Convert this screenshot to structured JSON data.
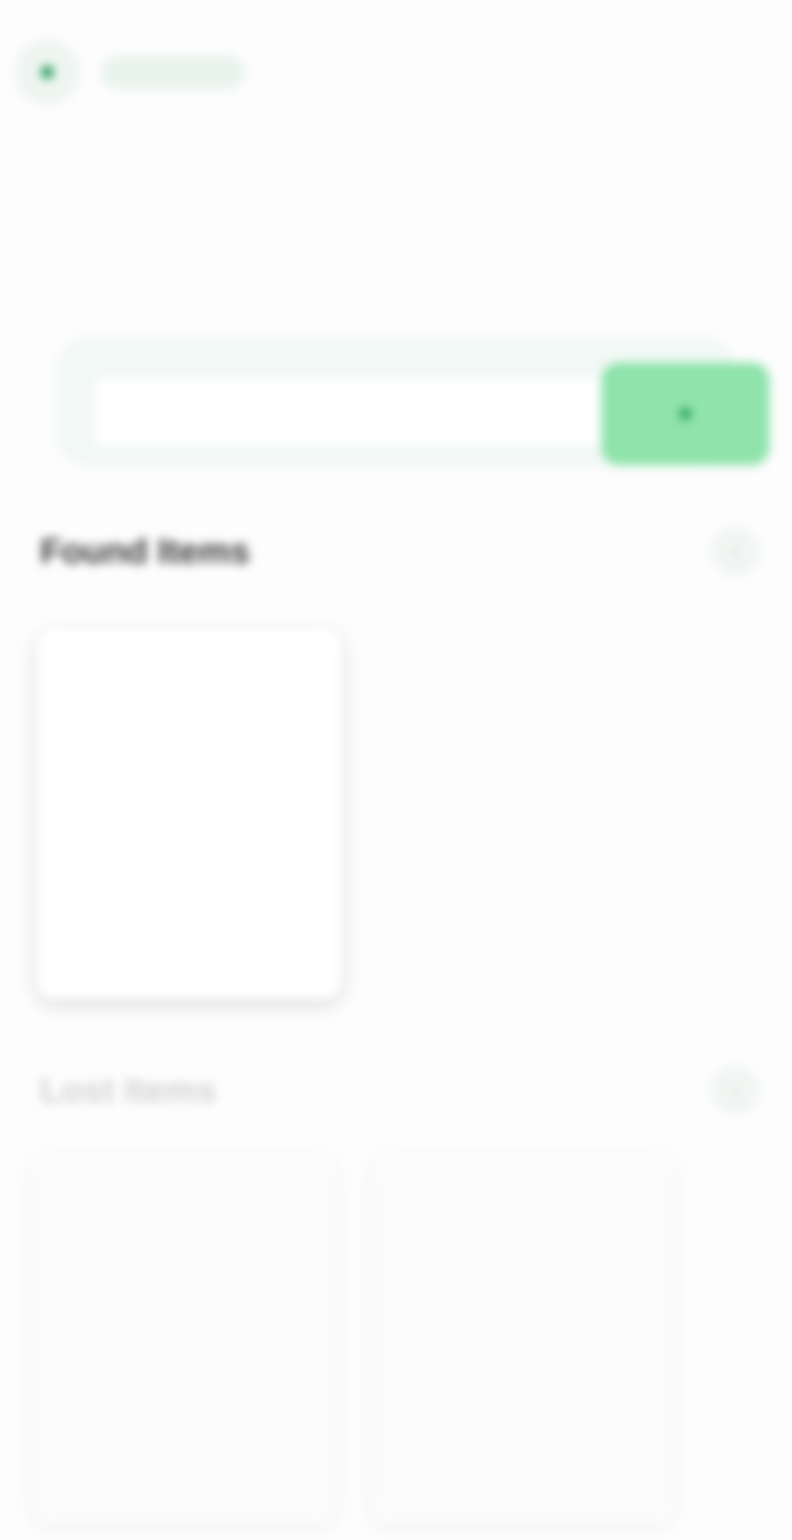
{
  "header": {
    "location_icon": "location-pin-icon",
    "location_label": ""
  },
  "hero": {
    "title": ""
  },
  "search": {
    "placeholder": "",
    "button_icon": "search-icon",
    "accent": "#8fe3ab"
  },
  "sections": [
    {
      "title": "Found Items",
      "action_icon": "chevron-right-icon",
      "action": "›"
    },
    {
      "title": "Lost Items",
      "action_icon": "chevron-right-icon",
      "action": "›"
    }
  ],
  "colors": {
    "brand_green": "#1f9a57",
    "accent_light": "#8fe3ab",
    "panel_bg": "#f2f8f5"
  }
}
